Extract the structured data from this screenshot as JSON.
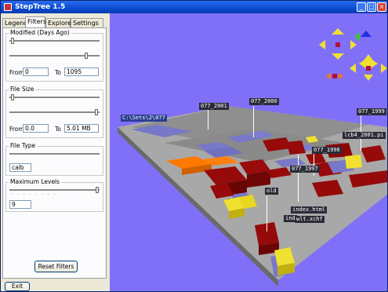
{
  "window": {
    "title": "StepTree 1.5"
  },
  "tabs": [
    {
      "label": "Legend"
    },
    {
      "label": "Filters"
    },
    {
      "label": "Explore"
    },
    {
      "label": "Settings"
    }
  ],
  "filters": {
    "modified": {
      "label": "Modified (Days Ago)",
      "from_label": "From",
      "from_value": "0",
      "to_label": "To",
      "to_value": "1095"
    },
    "filesize": {
      "label": "File Size",
      "from_label": "From",
      "from_value": "0.0",
      "to_label": "To",
      "to_value": "5.01 MB"
    },
    "filetype": {
      "label": "File Type",
      "value": "calb"
    },
    "maxlevels": {
      "label": "Maximum Levels",
      "value": "9"
    },
    "reset_label": "Reset Filters"
  },
  "footer": {
    "exit_label": "Exit"
  },
  "scene": {
    "labels": {
      "root": "C:\\Sets\\2\\077",
      "l2001": "077_2001",
      "l2000": "077_2000",
      "l1999": "077_1999",
      "l1996": "077_1996",
      "l1997": "077_1997",
      "lcb": "lcb4_2001.pi",
      "old": "old",
      "index": "index.html",
      "ind": "ind",
      "xchf": "wlt.xchf"
    }
  },
  "colors": {
    "background": "#8070f8",
    "dir_blue": "#7878c8",
    "file_red": "#960a0a",
    "file_orange": "#ff7800",
    "file_yellow": "#f0e030",
    "floor": "#9a9a9a"
  }
}
